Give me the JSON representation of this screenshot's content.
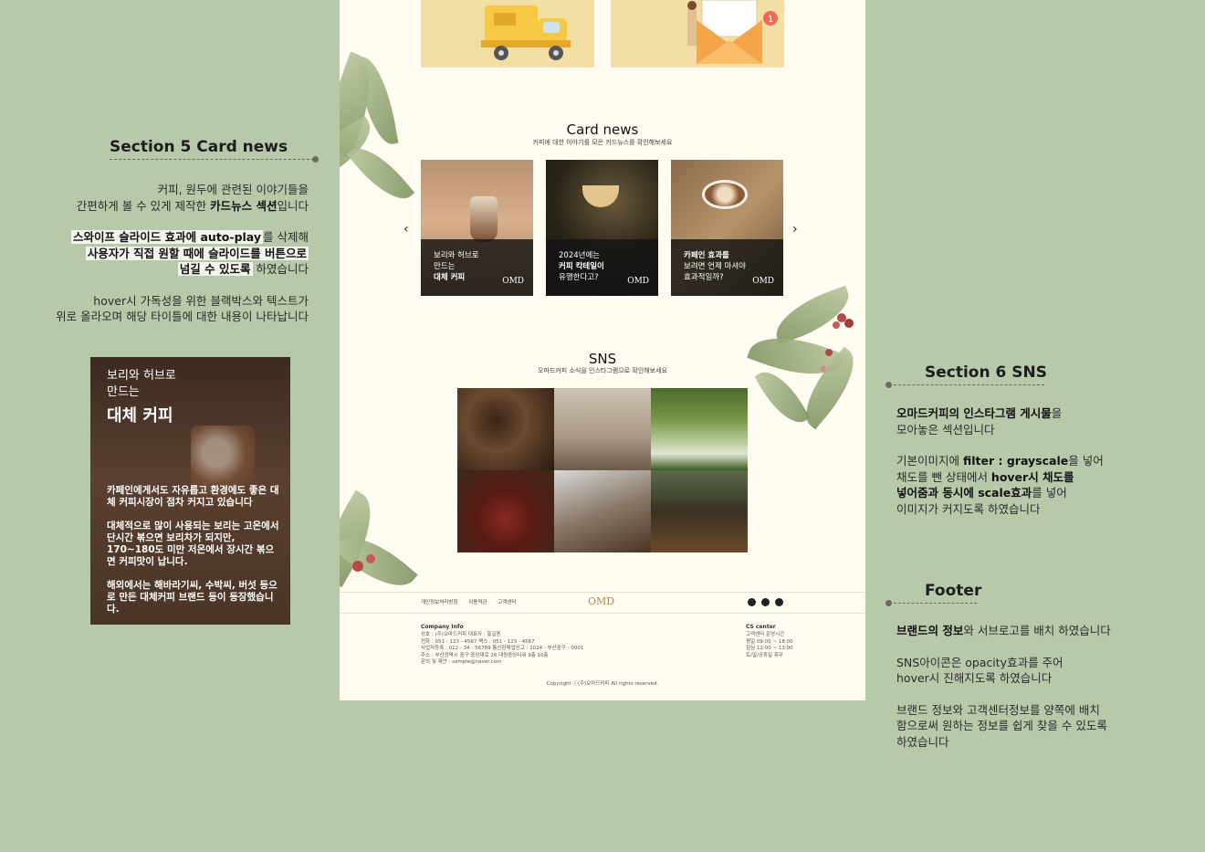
{
  "annotations": {
    "card_news": {
      "heading": "Section 5   Card news",
      "p1a": "커피, 원두에 관련된 이야기들을",
      "p1b_pre": "간편하게 볼 수 있게 제작한 ",
      "p1b_bold": "카드뉴스 섹션",
      "p1b_post": "입니다",
      "p2a_bold": "스와이프 슬라이드 효과에 auto-play",
      "p2a_post": "를 삭제해",
      "p2b_bold": "사용자가 직접 원할 때에 슬라이드를 버튼으로",
      "p2c_bold": "넘길 수 있도록",
      "p2c_post": " 하였습니다",
      "p3a": "hover시 가독성을 위한 블랙박스와 텍스트가",
      "p3b": "위로 올라오며 해당 타이틀에 대한 내용이 나타납니다"
    },
    "preview": {
      "kicker_1": "보리와 허브로",
      "kicker_2": "만드는",
      "title": "대체 커피",
      "body_1": "카페인에게서도 자유롭고 환경에도 좋은 대체 커피시장이 점차 커지고 있습니다",
      "body_2": "대체적으로 많이 사용되는 보리는 고온에서 단시간 볶으면 보리차가 되지만, 170~180도 미만 저온에서 장시간 볶으면 커피맛이 납니다.",
      "body_3": "해외에서는 해바라기씨, 수박씨, 버섯 등으로 만든 대체커피 브랜드 등이 등장했습니다."
    },
    "sns": {
      "heading": "Section 6   SNS",
      "p1a_bold": "오마드커피의 인스타그램 게시물",
      "p1a_post": "을",
      "p1b": "모아놓은 섹션입니다",
      "p2a_pre": "기본이미지에 ",
      "p2a_bold": "filter : grayscale",
      "p2a_post": "을 넣어",
      "p2b_pre": "채도를 뺀 상태에서 ",
      "p2b_bold": "hover시 채도를",
      "p2c_bold": "넣어줌과 동시에 scale효과",
      "p2c_post": "를 넣어",
      "p2d": "이미지가 커지도록 하였습니다"
    },
    "footer": {
      "heading": "Footer",
      "p1_bold": "브랜드의 정보",
      "p1_post": "와 서브로고를 배치 하였습니다",
      "p2a": "SNS아이콘은 opacity효과를 주어",
      "p2b": "hover시 진해지도록 하였습니다",
      "p3a": "브랜드 정보와 고객센터정보를 양쪽에 배치",
      "p3b": "함으로써 원하는 정보를 쉽게 찾을 수 있도록",
      "p3c": " 하였습니다"
    }
  },
  "page": {
    "card_news": {
      "title": "Card news",
      "subtitle": "커피에 대한 이야기를 모은 카드뉴스를 확인해보세요",
      "prev_arrow": "‹",
      "next_arrow": "›",
      "cards": [
        {
          "line1": "보리와 허브로",
          "line2": "만드는",
          "line3": "대체 커피",
          "logo": "OMD"
        },
        {
          "line1": "2024년에는",
          "line2": "커피 칵테일이",
          "line3": "유행한다고?",
          "logo": "OMD"
        },
        {
          "line1": "카페인 효과를",
          "line2": "보려면 언제 마셔야",
          "line3": "효과적일까?",
          "logo": "OMD"
        }
      ]
    },
    "sns": {
      "title": "SNS",
      "subtitle": "오마드커피 소식을 인스타그램으로 확인해보세요"
    },
    "footer": {
      "links": [
        "개인정보처리방침",
        "이용약관",
        "고객센터"
      ],
      "logo": "OMD",
      "company_title": "Company Info",
      "company_lines": [
        "상호 : (주)오마드커피      대표자 : 홍길동",
        "전화 : 051 - 123 - 4567      팩스 : 051 - 123 - 4567",
        "사업자등록 : 012 - 34 - 56789      통신판매업신고 : 2024 - 부산중구 - 0001",
        "주소 : 부산광역시 중구 중앙대로 26 대원중앙타워 9층 10층",
        "문의 및 제안 : sample@naver.com"
      ],
      "cs_title": "CS center",
      "cs_lines": [
        "고객센터 운영시간",
        "평일 09:00 ~ 18:00",
        "점심 12:00 ~ 13:00",
        "토/일/공휴일 휴무"
      ],
      "copyright": "Copyright ⓒ(주)오마드커피 All rights reserved."
    }
  },
  "colors": {
    "background": "#b8c9aa",
    "page": "#fffcf1",
    "accent_yellow": "#f3dfa6"
  }
}
